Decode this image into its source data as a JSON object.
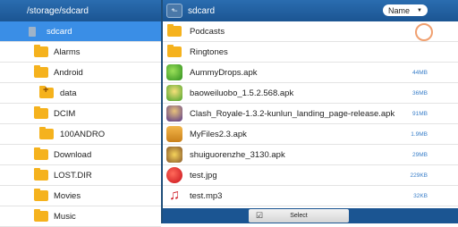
{
  "left": {
    "path": "/storage/sdcard",
    "items": [
      {
        "label": "sdcard",
        "icon": "sdcard-icon"
      },
      {
        "label": "Alarms",
        "icon": "folder-icon"
      },
      {
        "label": "Android",
        "icon": "folder-icon"
      },
      {
        "label": "data",
        "icon": "folder-plus-icon"
      },
      {
        "label": "DCIM",
        "icon": "folder-icon"
      },
      {
        "label": "100ANDRO",
        "icon": "folder-icon"
      },
      {
        "label": "Download",
        "icon": "folder-icon"
      },
      {
        "label": "LOST.DIR",
        "icon": "folder-icon"
      },
      {
        "label": "Movies",
        "icon": "folder-icon"
      },
      {
        "label": "Music",
        "icon": "folder-icon"
      }
    ]
  },
  "right": {
    "title": "sdcard",
    "sort": "Name",
    "files": [
      {
        "name": "Podcasts",
        "size": "",
        "icon": "folder-icon"
      },
      {
        "name": "Ringtones",
        "size": "",
        "icon": "folder-icon"
      },
      {
        "name": "AummyDrops.apk",
        "size": "44MB",
        "icon": "game-app-icon"
      },
      {
        "name": "baoweiluobo_1.5.2.568.apk",
        "size": "36MB",
        "icon": "game-app-icon"
      },
      {
        "name": "Clash_Royale-1.3.2-kunlun_landing_page-release.apk",
        "size": "91MB",
        "icon": "game-app-icon"
      },
      {
        "name": "MyFiles2.3.apk",
        "size": "1.9MB",
        "icon": "apk-icon"
      },
      {
        "name": "shuiguorenzhe_3130.apk",
        "size": "29MB",
        "icon": "game-app-icon"
      },
      {
        "name": "test.jpg",
        "size": "229KB",
        "icon": "image-icon"
      },
      {
        "name": "test.mp3",
        "size": "32KB",
        "icon": "music-note-icon"
      }
    ],
    "select_label": "Select"
  },
  "colors": {
    "header": "#1b5592",
    "selected": "#3a8ee6",
    "folder": "#f5b21d",
    "size_text": "#3a7fc9"
  }
}
